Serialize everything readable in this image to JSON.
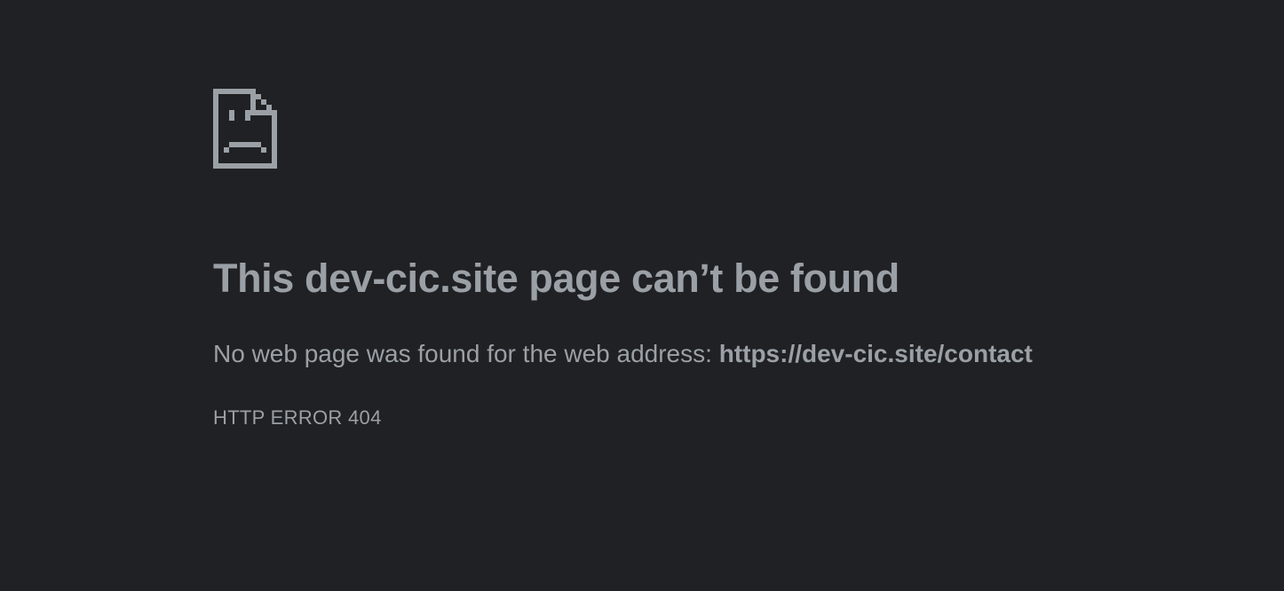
{
  "page": {
    "icon": "sad-document-icon",
    "headline": "This dev-cic.site page can’t be found",
    "message_prefix": "No web page was found for the web address: ",
    "url": "https://dev-cic.site/contact",
    "error_code": "HTTP ERROR 404"
  },
  "colors": {
    "background": "#202124",
    "text": "#9aa0a6"
  }
}
